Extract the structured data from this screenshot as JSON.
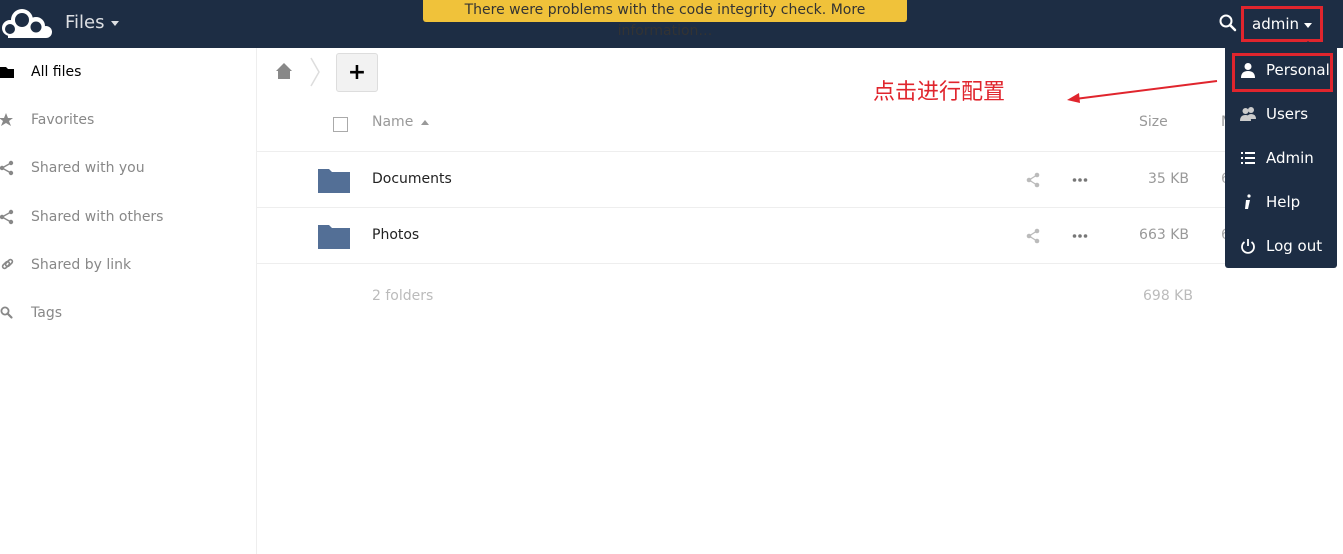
{
  "header": {
    "app_title": "Files",
    "notice": "There were problems with the code integrity check. More information…",
    "user": "admin"
  },
  "sidebar": {
    "items": [
      {
        "label": "All files",
        "icon": "folder-icon"
      },
      {
        "label": "Favorites",
        "icon": "star-icon"
      },
      {
        "label": "Shared with you",
        "icon": "share-icon"
      },
      {
        "label": "Shared with others",
        "icon": "share-icon"
      },
      {
        "label": "Shared by link",
        "icon": "link-icon"
      },
      {
        "label": "Tags",
        "icon": "tag-icon"
      }
    ]
  },
  "controls": {
    "add_label": "+"
  },
  "table": {
    "headers": {
      "name": "Name",
      "size": "Size",
      "modified": "M"
    },
    "rows": [
      {
        "name": "Documents",
        "size": "35 KB",
        "modified": "6"
      },
      {
        "name": "Photos",
        "size": "663 KB",
        "modified": "6"
      }
    ],
    "summary": {
      "count": "2 folders",
      "size": "698 KB"
    }
  },
  "annotation": {
    "text": "点击进行配置"
  },
  "dropdown": {
    "items": [
      {
        "label": "Personal",
        "icon": "person-icon"
      },
      {
        "label": "Users",
        "icon": "users-icon"
      },
      {
        "label": "Admin",
        "icon": "list-icon"
      },
      {
        "label": "Help",
        "icon": "info-icon"
      },
      {
        "label": "Log out",
        "icon": "power-icon"
      }
    ]
  },
  "colors": {
    "header_bg": "#1d2d44",
    "notice_bg": "#f0c23a",
    "folder": "#536f96",
    "annotation": "#e0252d"
  }
}
